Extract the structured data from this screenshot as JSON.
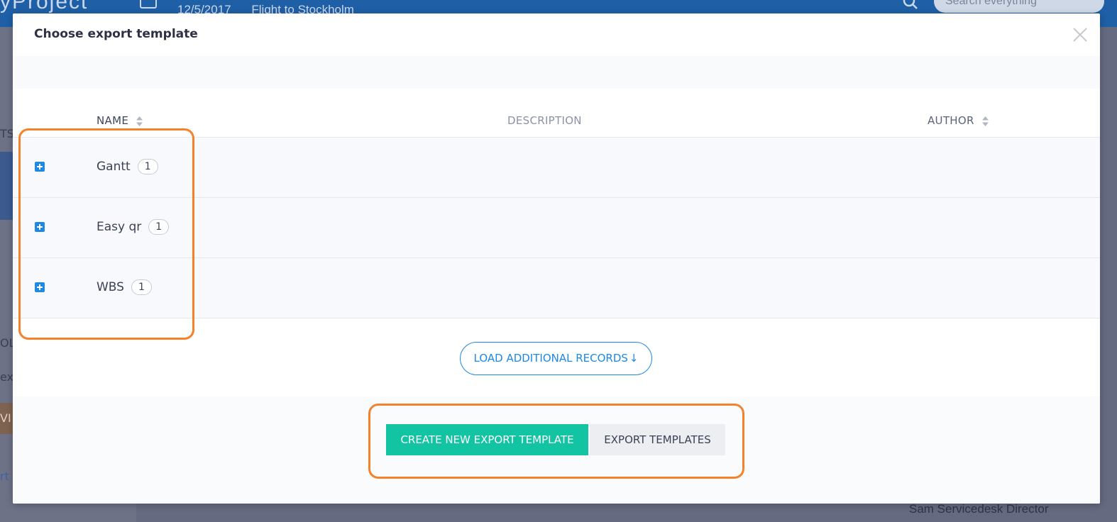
{
  "background": {
    "logo_text": "yProject",
    "breadcrumb": {
      "date": "12/5/2017",
      "project": "Flight to Stockholm"
    },
    "search_placeholder": "Search everything",
    "sidebar_fragments": [
      "TS",
      "OLL",
      "ex",
      "VI",
      "rt"
    ],
    "user_name": "Sam Servicedesk Director"
  },
  "modal": {
    "title": "Choose export template",
    "close_icon": "close-icon",
    "table": {
      "columns": {
        "name": "NAME",
        "description": "DESCRIPTION",
        "author": "AUTHOR"
      },
      "rows": [
        {
          "name": "Gantt",
          "count": "1",
          "description": "",
          "author": ""
        },
        {
          "name": "Easy qr",
          "count": "1",
          "description": "",
          "author": ""
        },
        {
          "name": "WBS",
          "count": "1",
          "description": "",
          "author": ""
        }
      ]
    },
    "load_more_label": "LOAD ADDITIONAL RECORDS",
    "load_more_icon": "arrow-down-icon",
    "buttons": {
      "create": "CREATE NEW EXPORT TEMPLATE",
      "export_templates": "EXPORT TEMPLATES"
    }
  },
  "colors": {
    "accent_blue": "#1e88e5",
    "primary_green": "#13c4a3",
    "highlight_orange": "#f5822a",
    "topbar_blue": "#1f5fa6"
  }
}
